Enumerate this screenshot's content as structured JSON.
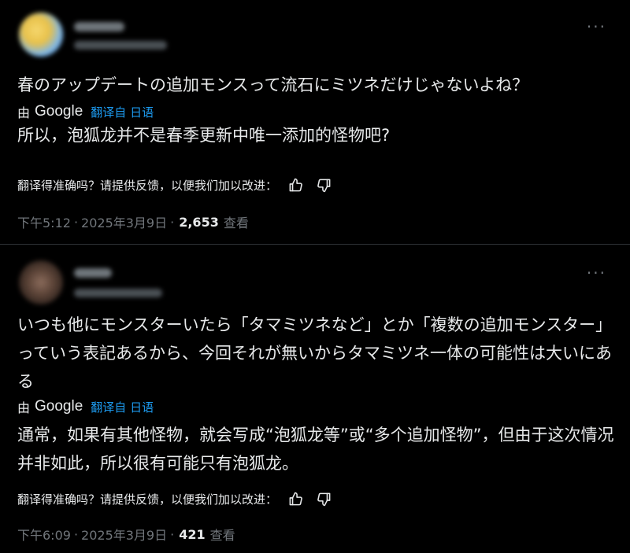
{
  "posts": [
    {
      "original_text": "春のアップデートの追加モンスって流石にミツネだけじゃないよね？",
      "translated_by": "由",
      "google": "Google",
      "translated_from": "翻译自 日语",
      "translated_text": "所以，泡狐龙并不是春季更新中唯一添加的怪物吧?",
      "feedback_prompt": "翻译得准确吗？请提供反馈，以便我们加以改进：",
      "time": "下午5:12",
      "date": "2025年3月9日",
      "views_count": "2,653",
      "views_label": "查看"
    },
    {
      "original_text": "いつも他にモンスターいたら「タマミツネなど」とか「複数の追加モンスター」っていう表記あるから、今回それが無いからタマミツネ一体の可能性は大いにある",
      "translated_by": "由",
      "google": "Google",
      "translated_from": "翻译自 日语",
      "translated_text": "通常，如果有其他怪物，就会写成“泡狐龙等”或“多个追加怪物”，但由于这次情况并非如此，所以很有可能只有泡狐龙。",
      "feedback_prompt": "翻译得准确吗？请提供反馈，以便我们加以改进：",
      "time": "下午6:09",
      "date": "2025年3月9日",
      "views_count": "421",
      "views_label": "查看"
    }
  ],
  "separator": "·",
  "more_glyph": "···",
  "icons": {
    "more": "more-horizontal-icon",
    "thumbs_up": "thumbs-up-icon",
    "thumbs_down": "thumbs-down-icon"
  },
  "colors": {
    "background": "#000000",
    "text": "#e7e9ea",
    "secondary": "#71767b",
    "link": "#1d9bf0"
  }
}
